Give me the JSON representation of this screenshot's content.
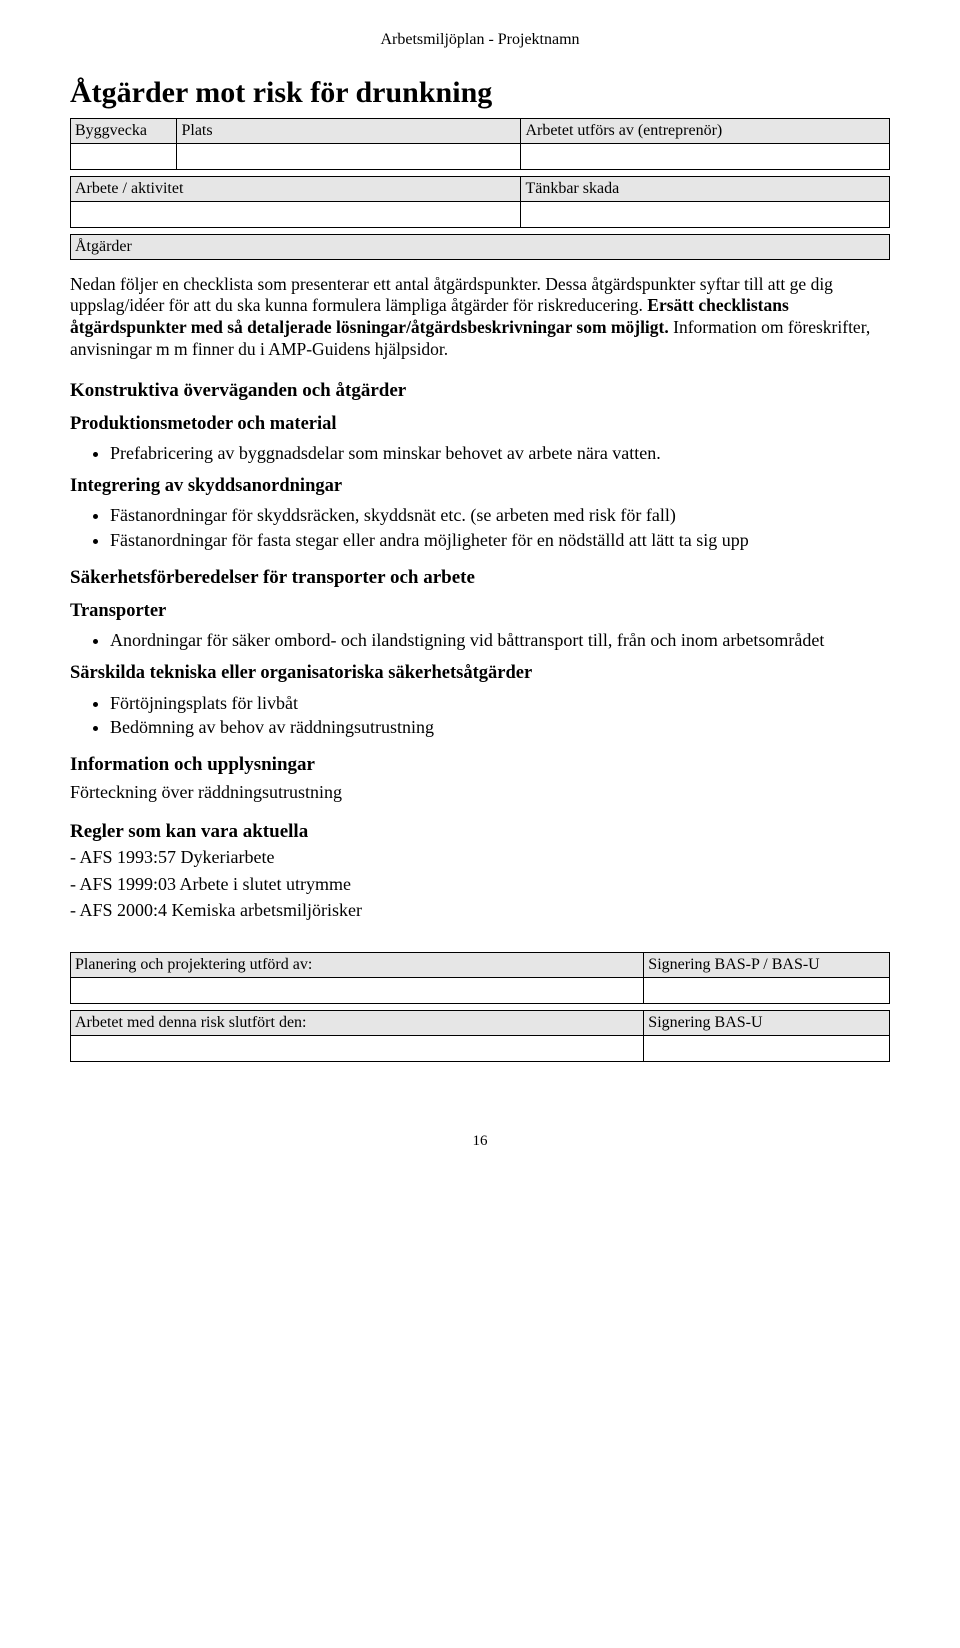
{
  "header": "Arbetsmiljöplan - Projektnamn",
  "title": "Åtgärder mot risk för drunkning",
  "table1": {
    "h1": "Byggvecka",
    "h2": "Plats",
    "h3": "Arbetet utförs av (entreprenör)"
  },
  "table2": {
    "h1": "Arbete / aktivitet",
    "h2": "Tänkbar skada"
  },
  "table3": {
    "h1": "Åtgärder"
  },
  "intro": "Nedan följer en checklista som presenterar ett antal åtgärdspunkter. Dessa åtgärdspunkter syftar till att ge dig uppslag/idéer för att du ska kunna formulera lämpliga åtgärder för riskreducering. Ersätt checklistans åtgärdspunkter med så detaljerade lösningar/åtgärdsbeskrivningar som möjligt. Information om föreskrifter, anvisningar m m finner du i AMP-Guidens hjälpsidor.",
  "sec1": "Konstruktiva överväganden och åtgärder",
  "sub1": "Produktionsmetoder och material",
  "b1": "Prefabricering av byggnadsdelar som minskar behovet av arbete nära vatten.",
  "sub2": "Integrering av skyddsanordningar",
  "b2a": "Fästanordningar för skyddsräcken, skyddsnät etc. (se arbeten med risk för fall)",
  "b2b": "Fästanordningar för fasta stegar eller andra möjligheter för en nödställd att lätt ta sig upp",
  "sec2": "Säkerhetsförberedelser för transporter och arbete",
  "sub3": "Transporter",
  "b3": "Anordningar för säker ombord- och ilandstigning vid båttransport till, från och inom arbetsområdet",
  "sub4": "Särskilda tekniska eller organisatoriska säkerhetsåtgärder",
  "b4a": "Förtöjningsplats för livbåt",
  "b4b": "Bedömning av behov av räddningsutrustning",
  "sec3": "Information och upplysningar",
  "line3": "Förteckning över räddningsutrustning",
  "sec4": "Regler som kan vara aktuella",
  "r1": "- AFS 1993:57 Dykeriarbete",
  "r2": "- AFS  1999:03 Arbete i slutet utrymme",
  "r3": "- AFS 2000:4 Kemiska arbetsmiljörisker",
  "ftable1": {
    "h1": "Planering och projektering utförd av:",
    "h2": "Signering BAS-P / BAS-U"
  },
  "ftable2": {
    "h1": "Arbetet med denna risk slutfört den:",
    "h2": "Signering BAS-U"
  },
  "pagenum": "16"
}
